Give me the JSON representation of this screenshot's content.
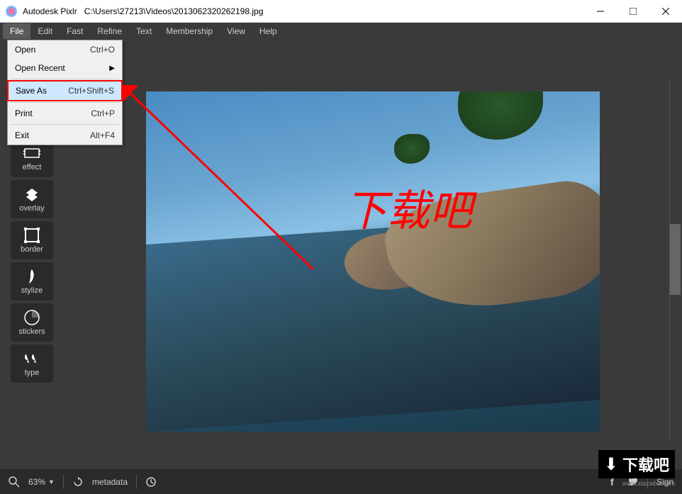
{
  "titlebar": {
    "app": "Autodesk Pixlr",
    "path": "C:\\Users\\27213\\Videos\\2013062320262198.jpg"
  },
  "menu": {
    "items": [
      "File",
      "Edit",
      "Fast",
      "Refine",
      "Text",
      "Membership",
      "View",
      "Help"
    ]
  },
  "dropdown": {
    "items": [
      {
        "label": "Open",
        "shortcut": "Ctrl+O",
        "type": "item"
      },
      {
        "label": "Open Recent",
        "shortcut": "",
        "type": "submenu"
      },
      {
        "type": "sep"
      },
      {
        "label": "Save As",
        "shortcut": "Ctrl+Shift+S",
        "type": "highlighted"
      },
      {
        "type": "sep"
      },
      {
        "label": "Print",
        "shortcut": "Ctrl+P",
        "type": "item"
      },
      {
        "type": "sep"
      },
      {
        "label": "Exit",
        "shortcut": "Alt+F4",
        "type": "item"
      }
    ]
  },
  "toolbar": {
    "items": [
      {
        "name": "effect",
        "label": "effect",
        "icon": "effect"
      },
      {
        "name": "overlay",
        "label": "overlay",
        "icon": "overlay"
      },
      {
        "name": "border",
        "label": "border",
        "icon": "border"
      },
      {
        "name": "stylize",
        "label": "stylize",
        "icon": "stylize"
      },
      {
        "name": "stickers",
        "label": "stickers",
        "icon": "stickers"
      },
      {
        "name": "type",
        "label": "type",
        "icon": "type"
      }
    ]
  },
  "canvas": {
    "overlay_text": "下载吧"
  },
  "bottombar": {
    "zoom": "63%",
    "metadata_label": "metadata",
    "sign_label": "Sign"
  },
  "watermark": {
    "text": "下载吧",
    "url": "www.xiazaiba.com"
  }
}
